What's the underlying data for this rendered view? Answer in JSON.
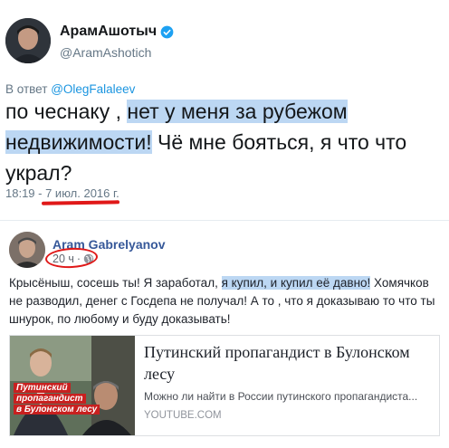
{
  "tweet": {
    "author_name": "АрамАшотыч",
    "author_handle": "@AramAshotich",
    "reply_prefix": "В ответ",
    "reply_mention": "@OlegFalaleev",
    "text_part1": "по чеснаку , ",
    "text_highlight": "нет у меня за рубежом недвижимости!",
    "text_part2": " Чё мне бояться, я что что украл?",
    "time": "18:19 - 7 июл. 2016 г."
  },
  "facebook_post": {
    "author_name": "Aram Gabrelyanov",
    "time_ago": "20 ч",
    "dot": "·",
    "text_part1": "Крысёныш, сосешь ты! Я заработал, ",
    "text_highlight": "я купил, и купил её давно!",
    "text_part2": " Хомячков не разводил, денег с Госдепа не получал! А то , что я доказываю то что ты шнурок, по любому и буду доказывать!",
    "link_card": {
      "title": "Путинский пропагандист в Булонском лесу",
      "description": "Можно ли найти в России путинского пропагандиста...",
      "domain": "YOUTUBE.COM",
      "thumbnail_caption": [
        "Путинский",
        "пропагандист",
        "в Булонском лесу"
      ]
    }
  },
  "icons": {
    "verified": "verified-badge-icon",
    "globe": "globe-icon"
  },
  "colors": {
    "highlight": "#bcd7f3",
    "annotation_red": "#e01818",
    "twitter_blue": "#1b95e0",
    "facebook_blue": "#365899"
  }
}
